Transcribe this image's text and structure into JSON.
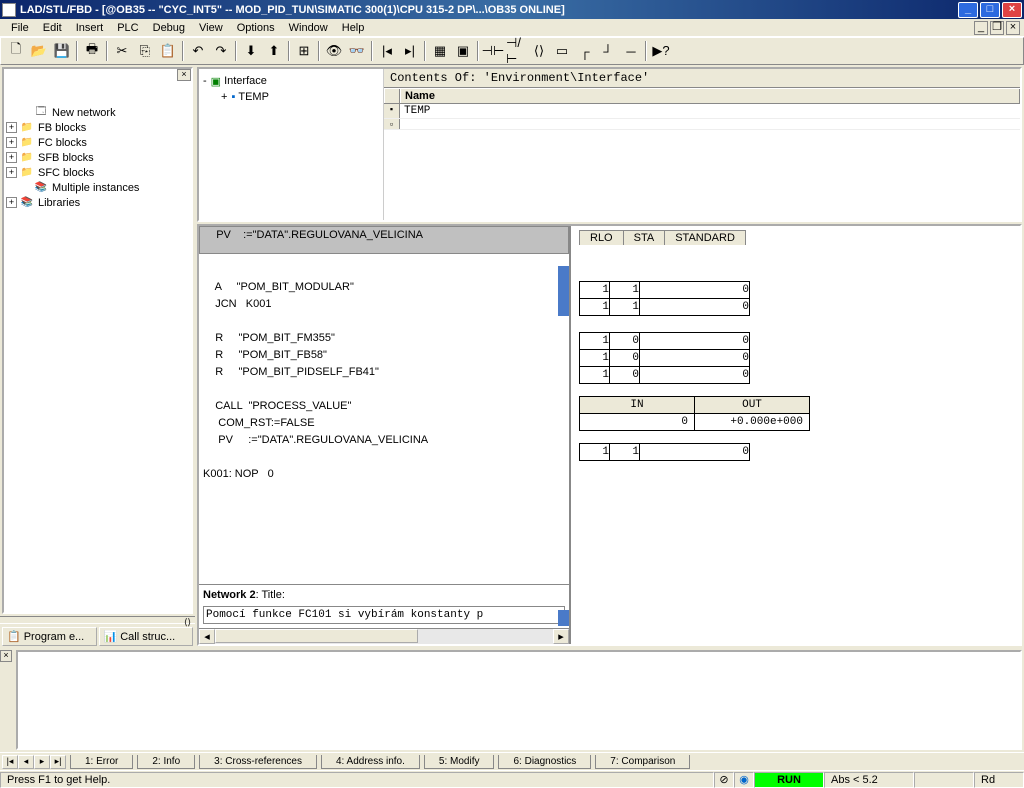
{
  "titlebar": {
    "text": "LAD/STL/FBD  - [@OB35 -- \"CYC_INT5\" -- MOD_PID_TUN\\SIMATIC 300(1)\\CPU 315-2 DP\\...\\OB35  ONLINE]"
  },
  "menu": [
    "File",
    "Edit",
    "Insert",
    "PLC",
    "Debug",
    "View",
    "Options",
    "Window",
    "Help"
  ],
  "project_tree": [
    {
      "label": "New network",
      "icon": "🗔",
      "exp": null,
      "indent": 1
    },
    {
      "label": "FB blocks",
      "icon": "📁",
      "exp": "+",
      "indent": 0
    },
    {
      "label": "FC blocks",
      "icon": "📁",
      "exp": "+",
      "indent": 0
    },
    {
      "label": "SFB blocks",
      "icon": "📁",
      "exp": "+",
      "indent": 0
    },
    {
      "label": "SFC blocks",
      "icon": "📁",
      "exp": "+",
      "indent": 0
    },
    {
      "label": "Multiple instances",
      "icon": "📚",
      "exp": null,
      "indent": 1
    },
    {
      "label": "Libraries",
      "icon": "📚",
      "exp": "+",
      "indent": 0
    }
  ],
  "bottom_tabs": [
    {
      "label": "Program e..."
    },
    {
      "label": "Call struc..."
    }
  ],
  "interface": {
    "header": "Contents Of: 'Environment\\Interface'",
    "col": "Name",
    "root": "Interface",
    "child": "TEMP",
    "row": "TEMP"
  },
  "code": {
    "header_line": "    PV    :=\"DATA\".REGULOVANA_VELICINA",
    "body": "\n    A     \"POM_BIT_MODULAR\"\n    JCN   K001\n\n    R     \"POM_BIT_FM355\"\n    R     \"POM_BIT_FB58\"\n    R     \"POM_BIT_PIDSELF_FB41\"\n\n    CALL  \"PROCESS_VALUE\"\n     COM_RST:=FALSE\n     PV     :=\"DATA\".REGULOVANA_VELICINA\n\nK001: NOP   0\n",
    "net2_label": "Network 2",
    "net2_title": ": Title:",
    "net2_desc": "Pomocí funkce FC101 si vybírám konstanty p"
  },
  "stl": {
    "cols": [
      "RLO",
      "STA",
      "STANDARD"
    ],
    "rows": [
      [
        "1",
        "1",
        "0"
      ],
      [
        "1",
        "1",
        "0"
      ],
      null,
      [
        "1",
        "0",
        "0"
      ],
      [
        "1",
        "0",
        "0"
      ],
      [
        "1",
        "0",
        "0"
      ]
    ],
    "io_hdr": [
      "IN",
      "OUT"
    ],
    "io_row": [
      "0",
      "+0.000e+000"
    ],
    "last": [
      "1",
      "1",
      "0"
    ]
  },
  "msg_tabs": [
    "1: Error",
    "2: Info",
    "3: Cross-references",
    "4: Address info.",
    "5: Modify",
    "6: Diagnostics",
    "7: Comparison"
  ],
  "status": {
    "help": "Press F1 to get Help.",
    "run": "RUN",
    "abs": "Abs < 5.2",
    "rd": "Rd"
  }
}
